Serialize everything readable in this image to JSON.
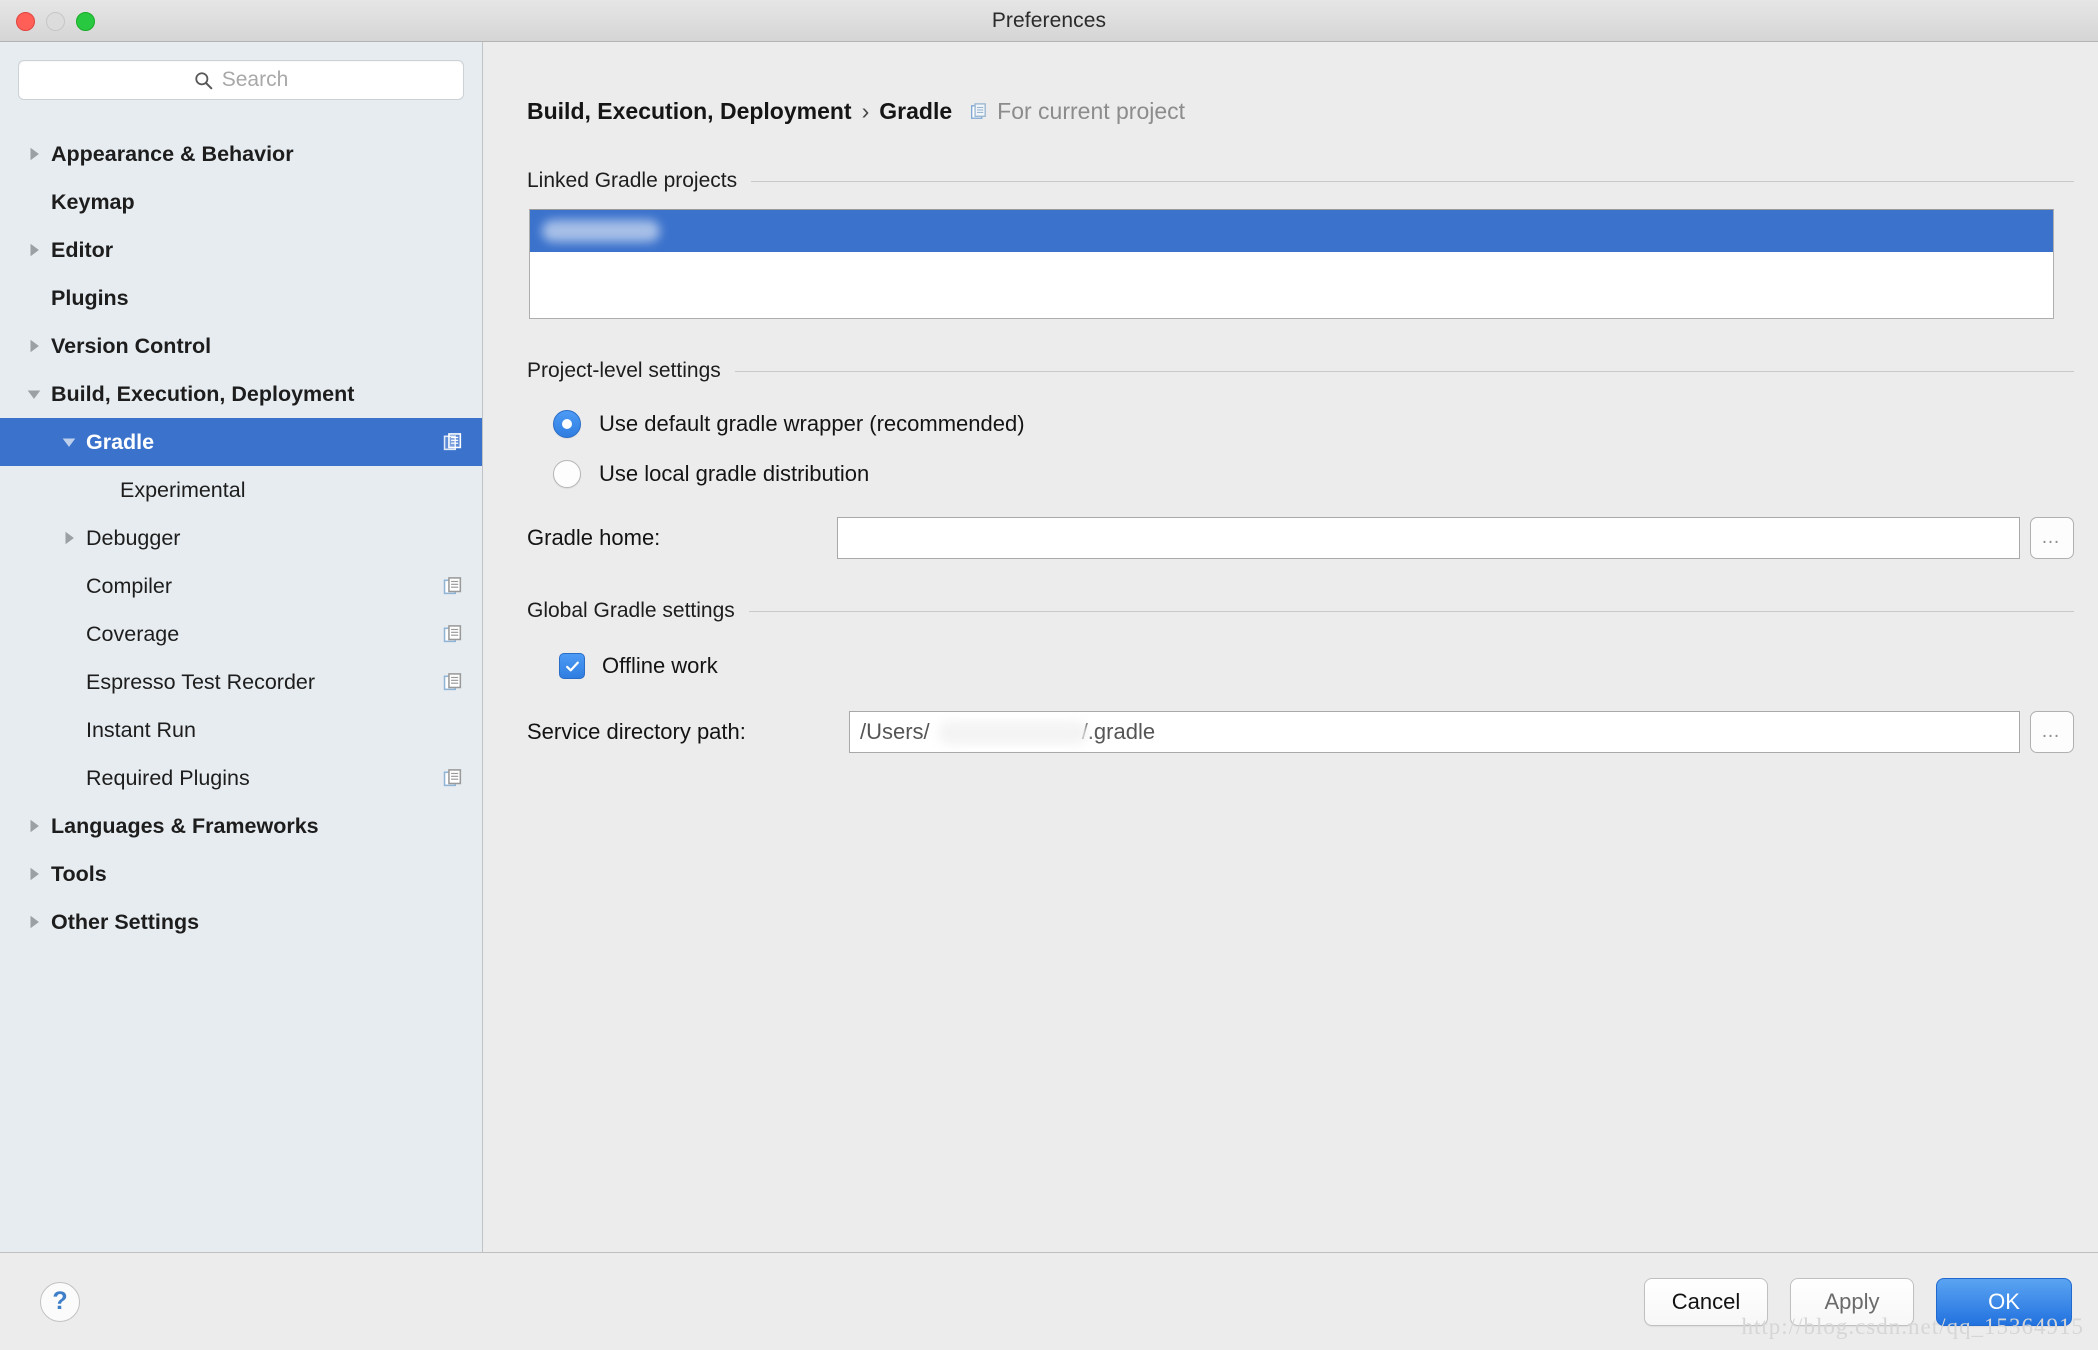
{
  "window": {
    "title": "Preferences",
    "traffic_lights": [
      "close",
      "minimize",
      "maximize"
    ]
  },
  "search": {
    "placeholder": "Search",
    "value": "",
    "icon": "search-icon"
  },
  "sidebar": {
    "items": [
      {
        "label": "Appearance & Behavior",
        "level": 0,
        "twisty": "collapsed",
        "bold": true,
        "selected": false,
        "badge": false
      },
      {
        "label": "Keymap",
        "level": 0,
        "twisty": "none",
        "bold": true,
        "selected": false,
        "badge": false
      },
      {
        "label": "Editor",
        "level": 0,
        "twisty": "collapsed",
        "bold": true,
        "selected": false,
        "badge": false
      },
      {
        "label": "Plugins",
        "level": 0,
        "twisty": "none",
        "bold": true,
        "selected": false,
        "badge": false
      },
      {
        "label": "Version Control",
        "level": 0,
        "twisty": "collapsed",
        "bold": true,
        "selected": false,
        "badge": false
      },
      {
        "label": "Build, Execution, Deployment",
        "level": 0,
        "twisty": "expanded",
        "bold": true,
        "selected": false,
        "badge": false
      },
      {
        "label": "Gradle",
        "level": 1,
        "twisty": "expanded",
        "bold": false,
        "selected": true,
        "badge": true
      },
      {
        "label": "Experimental",
        "level": 2,
        "twisty": "none",
        "bold": false,
        "selected": false,
        "badge": false
      },
      {
        "label": "Debugger",
        "level": 1,
        "twisty": "collapsed",
        "bold": false,
        "selected": false,
        "badge": false
      },
      {
        "label": "Compiler",
        "level": 1,
        "twisty": "none",
        "bold": false,
        "selected": false,
        "badge": true
      },
      {
        "label": "Coverage",
        "level": 1,
        "twisty": "none",
        "bold": false,
        "selected": false,
        "badge": true
      },
      {
        "label": "Espresso Test Recorder",
        "level": 1,
        "twisty": "none",
        "bold": false,
        "selected": false,
        "badge": true
      },
      {
        "label": "Instant Run",
        "level": 1,
        "twisty": "none",
        "bold": false,
        "selected": false,
        "badge": false
      },
      {
        "label": "Required Plugins",
        "level": 1,
        "twisty": "none",
        "bold": false,
        "selected": false,
        "badge": true
      },
      {
        "label": "Languages & Frameworks",
        "level": 0,
        "twisty": "collapsed",
        "bold": true,
        "selected": false,
        "badge": false
      },
      {
        "label": "Tools",
        "level": 0,
        "twisty": "collapsed",
        "bold": true,
        "selected": false,
        "badge": false
      },
      {
        "label": "Other Settings",
        "level": 0,
        "twisty": "collapsed",
        "bold": true,
        "selected": false,
        "badge": false
      }
    ]
  },
  "breadcrumb": {
    "parent": "Build, Execution, Deployment",
    "separator": "›",
    "current": "Gradle",
    "scope_icon": "project-scope-icon",
    "scope_text": "For current project"
  },
  "sections": {
    "linked_projects": {
      "title": "Linked Gradle projects",
      "selected_row_value": "",
      "selected_row_redacted": true
    },
    "project_level": {
      "title": "Project-level settings",
      "radio_default_wrapper": "Use default gradle wrapper (recommended)",
      "radio_local_distribution": "Use local gradle distribution",
      "selected_radio": "default_wrapper",
      "gradle_home_label": "Gradle home:",
      "gradle_home_value": "",
      "gradle_home_browse": "…"
    },
    "global_gradle": {
      "title": "Global Gradle settings",
      "offline_work_label": "Offline work",
      "offline_work_checked": true,
      "service_dir_label": "Service directory path:",
      "service_dir_value_prefix": "/Users/",
      "service_dir_value_suffix": "/.gradle",
      "service_dir_redacted": true,
      "service_dir_browse": "…"
    }
  },
  "footer": {
    "help_label": "?",
    "cancel_label": "Cancel",
    "apply_label": "Apply",
    "ok_label": "OK"
  },
  "watermark": {
    "text": "http://blog.csdn.net/qq_15364915"
  },
  "colors": {
    "accent_blue": "#3b72cc",
    "sidebar_bg": "#e7ecf0",
    "content_bg": "#ececec",
    "primary_button": "#2272df",
    "traffic_red": "#ff5f57",
    "traffic_yellow": "#dcdcdc",
    "traffic_green": "#28c840"
  }
}
